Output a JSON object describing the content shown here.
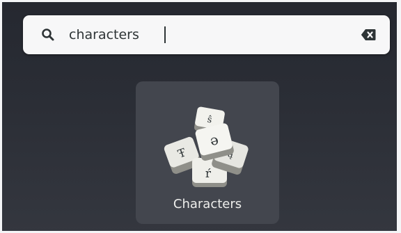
{
  "search": {
    "value": "characters",
    "icon": "search-icon",
    "clear_icon": "clear-text-icon"
  },
  "results": [
    {
      "label": "Characters",
      "icon": "characters-app-icon"
    }
  ],
  "colors": {
    "background": "#2b2e36",
    "search_bg": "#f7f7f8",
    "tile_bg": "#43464e",
    "label": "#eeeeec"
  }
}
